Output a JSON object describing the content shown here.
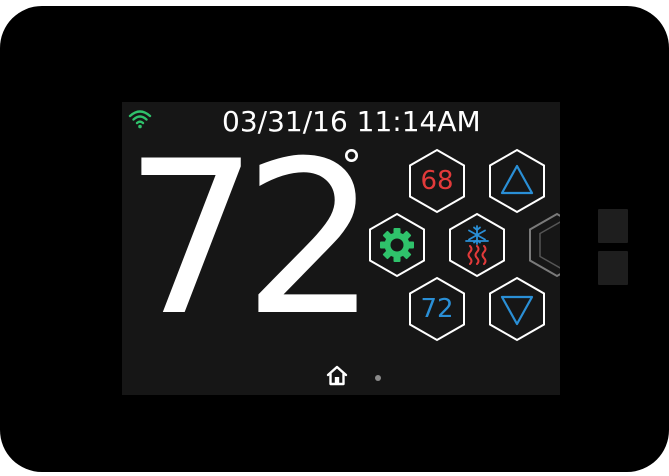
{
  "status_bar": {
    "wifi_icon": "wifi-icon",
    "datetime": "03/31/16 11:14AM"
  },
  "current_temperature": {
    "value": "72",
    "degree_symbol": "°"
  },
  "controls": {
    "heat_setpoint": "68",
    "cool_setpoint": "72",
    "increase_icon": "triangle-up-icon",
    "decrease_icon": "triangle-down-icon",
    "settings_icon": "gear-icon",
    "mode_icon": "heat-cool-mode-icon"
  },
  "footer": {
    "home_icon": "home-icon",
    "page_indicator": "dot"
  },
  "colors": {
    "device_body": "#000000",
    "screen_bg": "#161616",
    "text": "#ffffff",
    "wifi": "#2fc26b",
    "heat": "#e23a3a",
    "cool": "#2a8fd6",
    "gear": "#2fc26b",
    "hex_outline": "#ffffff"
  }
}
